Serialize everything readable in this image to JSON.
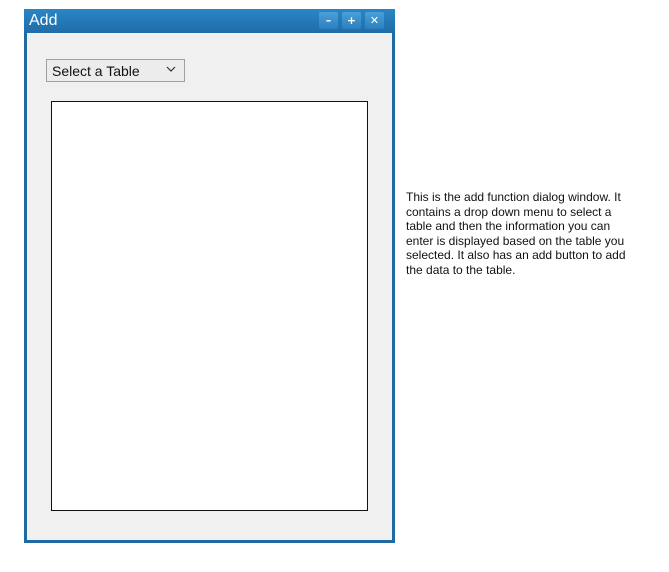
{
  "window": {
    "title": "Add",
    "controls": {
      "minimize": "–",
      "maximize": "+",
      "close": "✕"
    }
  },
  "table_select": {
    "selected": "Select a Table",
    "icon": "chevron-down-icon"
  },
  "note": {
    "text": "This is the add function dialog window. It contains a drop down menu to select a table and then the information you can enter is displayed based on the table you selected. It also has an add button to add the data to the table."
  },
  "colors": {
    "titlebar": "#1f6ca8",
    "window_border": "#1f6aa2",
    "window_bg": "#f0f0f0"
  }
}
